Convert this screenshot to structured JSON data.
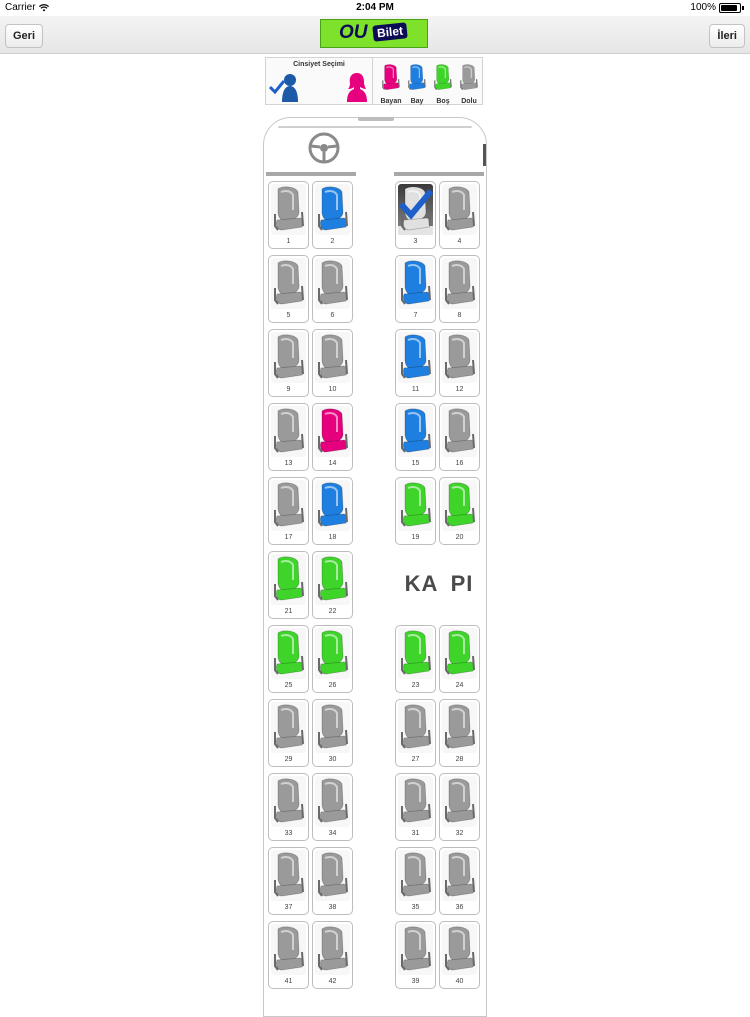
{
  "status_bar": {
    "carrier": "Carrier",
    "time": "2:04 PM",
    "battery": "100%",
    "battery_level": 1.0
  },
  "nav": {
    "back_label": "Geri",
    "next_label": "İleri",
    "logo_ou": "OU",
    "logo_bilet": "Bilet"
  },
  "legend": {
    "gender_title": "Cinsiyet Seçimi",
    "items": [
      {
        "label": "Bayan",
        "status": "female"
      },
      {
        "label": "Bay",
        "status": "male"
      },
      {
        "label": "Boş",
        "status": "empty"
      },
      {
        "label": "Dolu",
        "status": "full"
      }
    ]
  },
  "colors": {
    "female": "#e6007e",
    "male": "#1e7fe0",
    "empty": "#3fd42a",
    "full": "#9a9a9a",
    "selected_check": "#1f5fc9",
    "logo_green": "#7ee12a",
    "logo_navy": "#0c0c55"
  },
  "door_label": "KA PI",
  "seats": [
    {
      "number": "1",
      "status": "full"
    },
    {
      "number": "2",
      "status": "male"
    },
    {
      "number": "3",
      "status": "selected"
    },
    {
      "number": "4",
      "status": "full"
    },
    {
      "number": "5",
      "status": "full"
    },
    {
      "number": "6",
      "status": "full"
    },
    {
      "number": "7",
      "status": "male"
    },
    {
      "number": "8",
      "status": "full"
    },
    {
      "number": "9",
      "status": "full"
    },
    {
      "number": "10",
      "status": "full"
    },
    {
      "number": "11",
      "status": "male"
    },
    {
      "number": "12",
      "status": "full"
    },
    {
      "number": "13",
      "status": "full"
    },
    {
      "number": "14",
      "status": "female"
    },
    {
      "number": "15",
      "status": "male"
    },
    {
      "number": "16",
      "status": "full"
    },
    {
      "number": "17",
      "status": "full"
    },
    {
      "number": "18",
      "status": "male"
    },
    {
      "number": "19",
      "status": "empty"
    },
    {
      "number": "20",
      "status": "empty"
    },
    {
      "number": "21",
      "status": "empty"
    },
    {
      "number": "22",
      "status": "empty"
    },
    {
      "number": "25",
      "status": "empty"
    },
    {
      "number": "26",
      "status": "empty"
    },
    {
      "number": "23",
      "status": "empty"
    },
    {
      "number": "24",
      "status": "empty"
    },
    {
      "number": "29",
      "status": "full"
    },
    {
      "number": "30",
      "status": "full"
    },
    {
      "number": "27",
      "status": "full"
    },
    {
      "number": "28",
      "status": "full"
    },
    {
      "number": "33",
      "status": "full"
    },
    {
      "number": "34",
      "status": "full"
    },
    {
      "number": "31",
      "status": "full"
    },
    {
      "number": "32",
      "status": "full"
    },
    {
      "number": "37",
      "status": "full"
    },
    {
      "number": "38",
      "status": "full"
    },
    {
      "number": "35",
      "status": "full"
    },
    {
      "number": "36",
      "status": "full"
    },
    {
      "number": "41",
      "status": "full"
    },
    {
      "number": "42",
      "status": "full"
    },
    {
      "number": "39",
      "status": "full"
    },
    {
      "number": "40",
      "status": "full"
    }
  ]
}
